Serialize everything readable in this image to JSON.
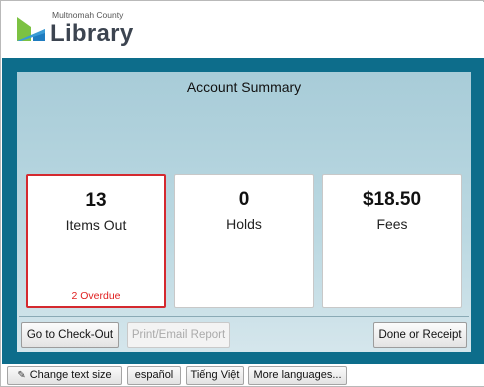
{
  "header": {
    "logo_subtitle": "Multnomah County",
    "logo_title": "Library"
  },
  "summary": {
    "title": "Account Summary",
    "cards": [
      {
        "value": "13",
        "label": "Items Out",
        "note": "2 Overdue"
      },
      {
        "value": "0",
        "label": "Holds"
      },
      {
        "value": "$18.50",
        "label": "Fees"
      }
    ]
  },
  "actions": {
    "checkout_label": "Go to Check-Out",
    "print_label": "Print/Email Report",
    "done_label": "Done or Receipt"
  },
  "footer": {
    "text_size_label": "Change text size",
    "text_size_icon": "text-size-icon",
    "lang_es": "español",
    "lang_vi": "Tiếng Việt",
    "more_languages": "More languages..."
  },
  "colors": {
    "panel_bg": "#0d6d8b",
    "card_selected_border": "#d4292f",
    "overdue_text": "#e02020",
    "logo_green": "#7cc242",
    "logo_blue": "#1f7cc0"
  }
}
